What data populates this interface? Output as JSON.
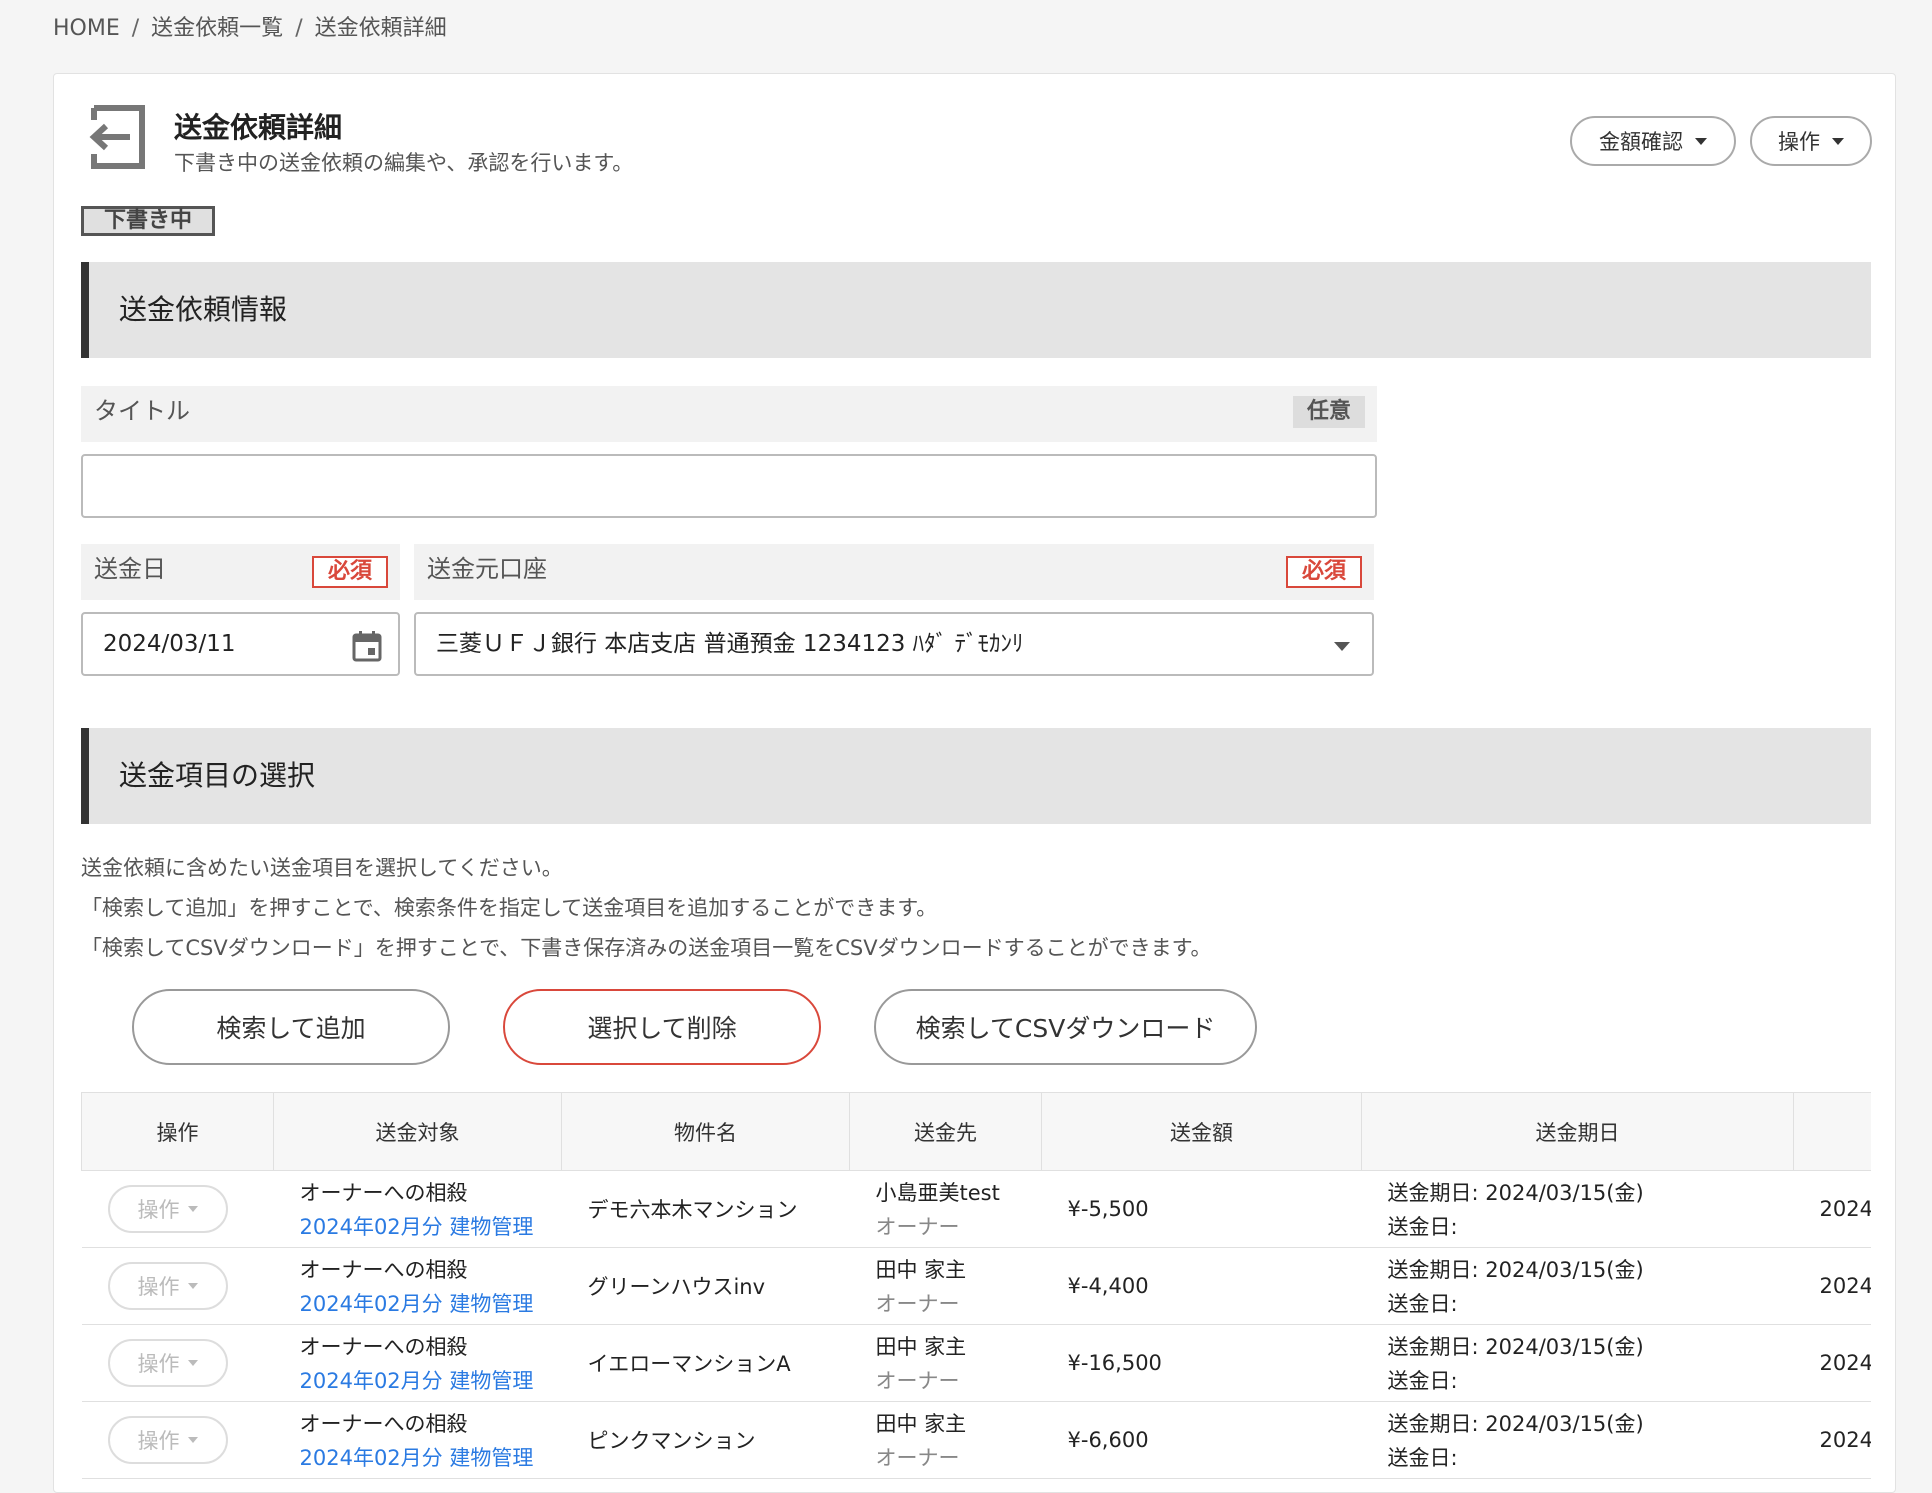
{
  "breadcrumb": [
    "HOME",
    "送金依頼一覧",
    "送金依頼詳細"
  ],
  "header": {
    "title": "送金依頼詳細",
    "subtitle": "下書き中の送金依頼の編集や、承認を行います。",
    "amount_check_label": "金額確認",
    "actions_label": "操作"
  },
  "status_badge": "下書き中",
  "section1": {
    "title": "送金依頼情報",
    "title_field_label": "タイトル",
    "optional_tag": "任意",
    "title_value": "",
    "date_label": "送金日",
    "required_tag": "必須",
    "date_value": "2024/03/11",
    "account_label": "送金元口座",
    "account_value": "三菱ＵＦＪ銀行 本店支店 普通預金 1234123 ﾊﾀﾞ ﾃﾞﾓｶﾝﾘ"
  },
  "section2": {
    "title": "送金項目の選択",
    "desc1": "送金依頼に含めたい送金項目を選択してください。",
    "desc2": "「検索して追加」を押すことで、検索条件を指定して送金項目を追加することができます。",
    "desc3": "「検索してCSVダウンロード」を押すことで、下書き保存済みの送金項目一覧をCSVダウンロードすることができます。",
    "search_add_label": "検索して追加",
    "select_delete_label": "選択して削除",
    "search_csv_label": "検索してCSVダウンロード"
  },
  "table": {
    "headers": [
      "操作",
      "送金対象",
      "物件名",
      "送金先",
      "送金額",
      "送金期日"
    ],
    "rows": [
      {
        "op": "操作",
        "target": "オーナーへの相殺",
        "target_link": "2024年02月分 建物管理",
        "property": "デモ六本木マンション",
        "payee": "小島亜美test",
        "payee_role": "オーナー",
        "amount": "¥-5,500",
        "due": "送金期日: 2024/03/15(金)",
        "sent": "送金日:",
        "extra": "2024"
      },
      {
        "op": "操作",
        "target": "オーナーへの相殺",
        "target_link": "2024年02月分 建物管理",
        "property": "グリーンハウスinv",
        "payee": "田中 家主",
        "payee_role": "オーナー",
        "amount": "¥-4,400",
        "due": "送金期日: 2024/03/15(金)",
        "sent": "送金日:",
        "extra": "2024"
      },
      {
        "op": "操作",
        "target": "オーナーへの相殺",
        "target_link": "2024年02月分 建物管理",
        "property": "イエローマンションA",
        "payee": "田中 家主",
        "payee_role": "オーナー",
        "amount": "¥-16,500",
        "due": "送金期日: 2024/03/15(金)",
        "sent": "送金日:",
        "extra": "2024"
      },
      {
        "op": "操作",
        "target": "オーナーへの相殺",
        "target_link": "2024年02月分 建物管理",
        "property": "ピンクマンション",
        "payee": "田中 家主",
        "payee_role": "オーナー",
        "amount": "¥-6,600",
        "due": "送金期日: 2024/03/15(金)",
        "sent": "送金日:",
        "extra": "2024"
      }
    ]
  }
}
